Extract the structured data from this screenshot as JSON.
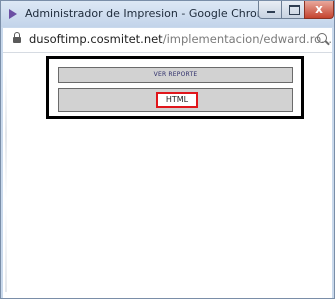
{
  "window": {
    "title": "Administrador de Impresion - Google Chrome",
    "app_icon": "chrome-page-icon",
    "close_label": "x"
  },
  "addressbar": {
    "url_host": "dusoftimp.cosmitet.net",
    "url_path": "/implementacion/edward.ro...",
    "lock_icon": "lock-icon",
    "zoom_icon": "zoom-icon"
  },
  "main": {
    "report_button_label": "VER REPORTE",
    "html_button_label": "HTML"
  },
  "colors": {
    "panel_border": "#000000",
    "highlight_border": "#e0161b",
    "button_background": "#d2d2d2",
    "title_bar": "#c3d4ea"
  }
}
